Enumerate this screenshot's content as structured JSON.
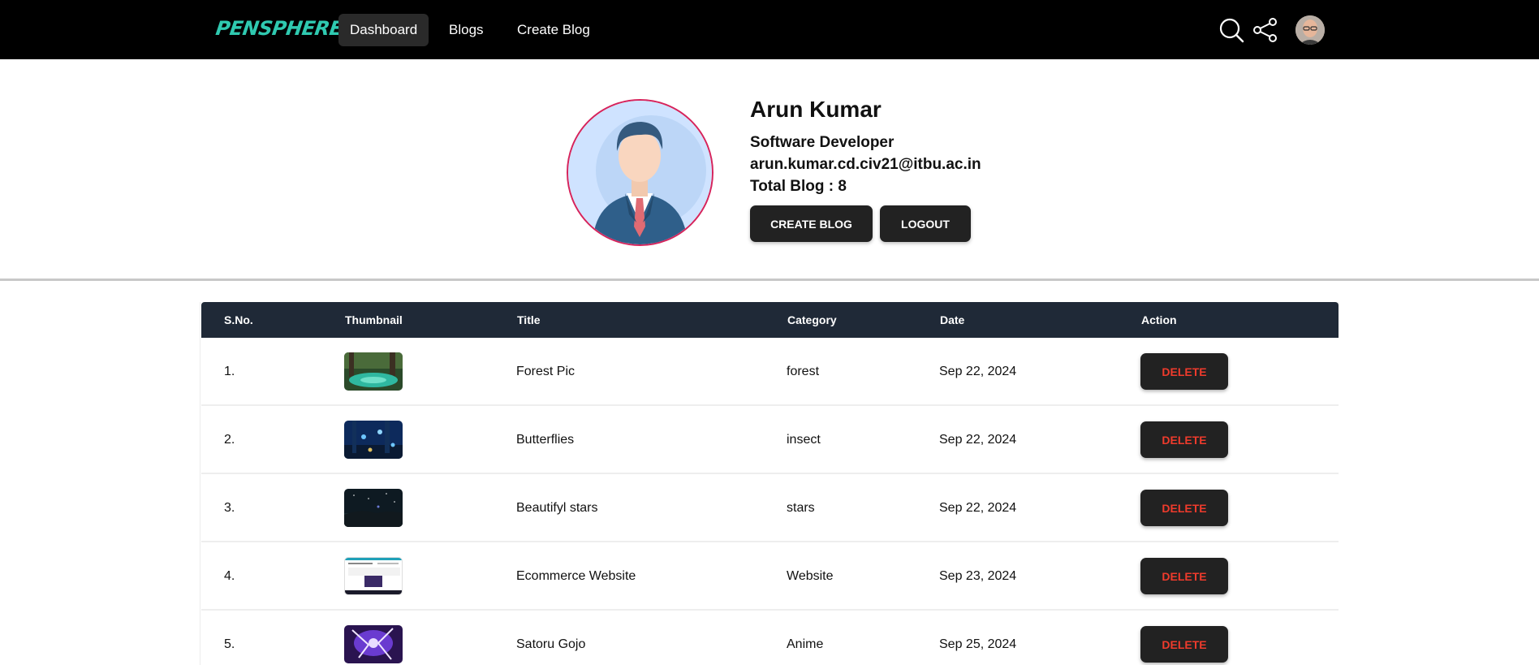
{
  "navbar": {
    "logo_text": "PENSPHERE",
    "links": [
      "Dashboard",
      "Blogs",
      "Create Blog"
    ],
    "icons": [
      "search-icon",
      "share-icon",
      "user-avatar"
    ]
  },
  "profile": {
    "name": "Arun Kumar",
    "role": "Software Developer",
    "email": "arun.kumar.cd.civ21@itbu.ac.in",
    "total_blog": "Total Blog : 8",
    "create_label": "CREATE BLOG",
    "logout_label": "LOGOUT"
  },
  "table": {
    "headers": [
      "S.No.",
      "Thumbnail",
      "Title",
      "Category",
      "Date",
      "Action"
    ],
    "rows": [
      {
        "sno": "1.",
        "title": "Forest Pic",
        "category": "forest",
        "date": "Sep 22, 2024",
        "action": "DELETE",
        "thumb": "forest-thumbnail"
      },
      {
        "sno": "2.",
        "title": "Butterflies",
        "category": "insect",
        "date": "Sep 22, 2024",
        "action": "DELETE",
        "thumb": "butterflies-thumbnail"
      },
      {
        "sno": "3.",
        "title": "Beautifyl stars",
        "category": "stars",
        "date": "Sep 22, 2024",
        "action": "DELETE",
        "thumb": "stars-thumbnail"
      },
      {
        "sno": "4.",
        "title": "Ecommerce Website",
        "category": "Website",
        "date": "Sep 23, 2024",
        "action": "DELETE",
        "thumb": "website-thumbnail"
      },
      {
        "sno": "5.",
        "title": "Satoru Gojo",
        "category": "Anime",
        "date": "Sep 25, 2024",
        "action": "DELETE",
        "thumb": "anime-thumbnail"
      }
    ]
  },
  "colors": {
    "navbar_bg": "#000000",
    "logo": "#2fc9b0",
    "table_header_bg": "#1f2937",
    "button_bg": "#222222",
    "delete_text": "#ef3b2c",
    "profile_ring": "#d6245c"
  }
}
